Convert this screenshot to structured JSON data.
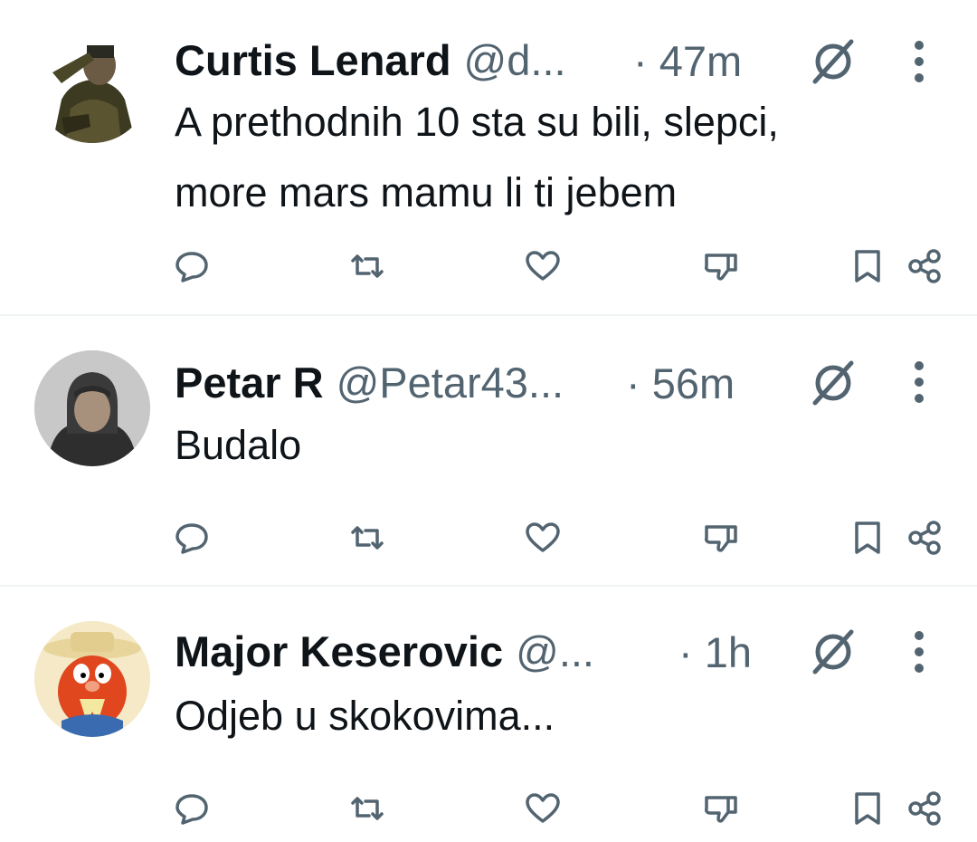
{
  "colors": {
    "text": "#0f1419",
    "secondary": "#536471",
    "divider": "#eff3f4"
  },
  "tweets": [
    {
      "name": "Curtis Lenard",
      "handle": "@d...",
      "time": "· 47m",
      "text": "A prethodnih 10 sta su bili, slepci,\nmore mars mamu li ti jebem",
      "avatar": "soldier-saluting-avatar"
    },
    {
      "name": "Petar R",
      "handle": "@Petar43...",
      "time": "· 56m",
      "text": "Budalo",
      "avatar": "hooded-man-avatar"
    },
    {
      "name": "Major Keserovic",
      "handle": "@...",
      "time": "· 1h",
      "text": "Odjeb u skokovima...",
      "avatar": "cartoon-sam-avatar"
    }
  ],
  "action_icons": [
    "reply-icon",
    "retweet-icon",
    "like-icon",
    "dislike-icon",
    "bookmark-icon",
    "share-icon"
  ]
}
